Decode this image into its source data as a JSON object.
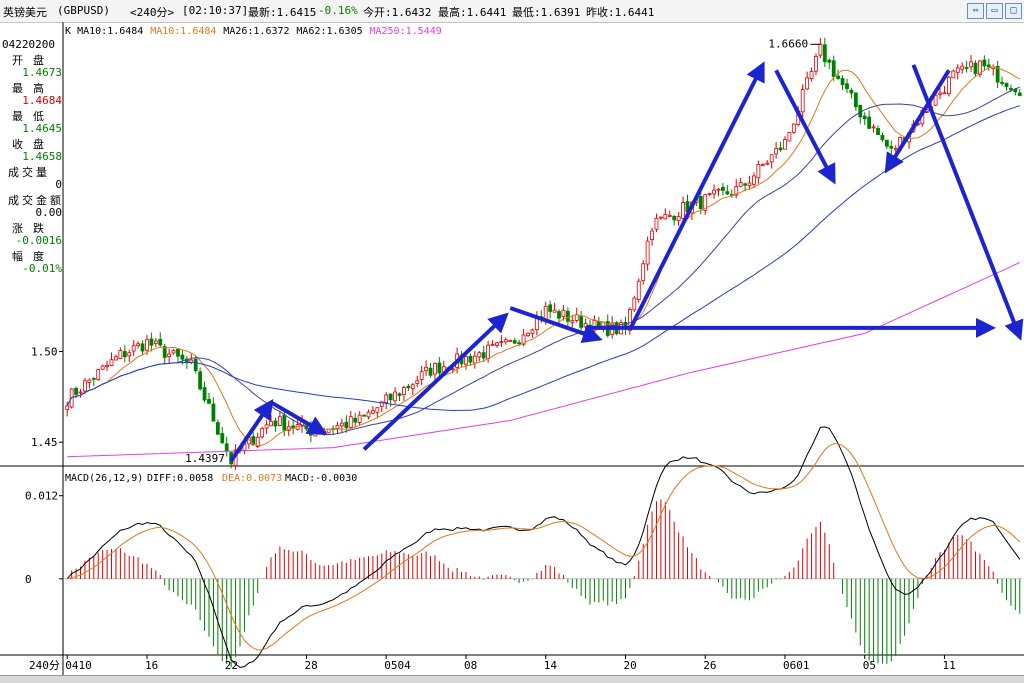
{
  "window": {
    "name": "英镑美元",
    "code": "(GBPUSD)",
    "period": "<240分>",
    "time": "[02:10:37]",
    "latest": "最新:1.6415",
    "change_pct": "-0.16%",
    "open_today": "今开:1.6432",
    "high": "最高:1.6441",
    "low": "最低:1.6391",
    "prev_close": "昨收:1.6441"
  },
  "left_panel": {
    "date": "04220200",
    "items": [
      {
        "label": "开盘",
        "value": "1.4673",
        "color": "#008000"
      },
      {
        "label": "最高",
        "value": "1.4684",
        "color": "#e00000"
      },
      {
        "label": "最低",
        "value": "1.4645",
        "color": "#008000"
      },
      {
        "label": "收盘",
        "value": "1.4658",
        "color": "#008000"
      },
      {
        "label": "成交量",
        "value": "0",
        "color": "#000000"
      },
      {
        "label": "成交金额",
        "value": "0.00",
        "color": "#000000"
      },
      {
        "label": "涨跌",
        "value": "-0.0016",
        "color": "#008000"
      },
      {
        "label": "幅度",
        "value": "-0.01%",
        "color": "#008000"
      }
    ]
  },
  "colors": {
    "up": "#e00000",
    "down": "#008000",
    "ma10": "#e07820",
    "ma26": "#4040a0",
    "ma62": "#2040c0",
    "ma250": "#e040e0",
    "annotation": "#1c24d0",
    "diff": "#000000",
    "dea": "#e07820"
  },
  "chart_data": [
    {
      "type": "candlestick",
      "legend": [
        {
          "label": "K",
          "color": "#000000"
        },
        {
          "label": "MA10:1.6484",
          "color": "#000000"
        },
        {
          "label": "MA10:1.6484",
          "color": "#e07820"
        },
        {
          "label": "MA26:1.6372",
          "color": "#000000"
        },
        {
          "label": "MA62:1.6305",
          "color": "#000000"
        },
        {
          "label": "MA250:1.5449",
          "color": "#e040e0"
        }
      ],
      "yticks": [
        1.45,
        1.5
      ],
      "ylim": [
        1.438,
        1.675
      ],
      "annotations": [
        {
          "text": "1.6660",
          "x": 170,
          "y": 1.666
        },
        {
          "text": "1.4397",
          "x": 37,
          "y": 1.4397
        }
      ],
      "x_ticks": [
        {
          "label": "0410",
          "index": 0
        },
        {
          "label": "16",
          "index": 18
        },
        {
          "label": "22",
          "index": 36
        },
        {
          "label": "28",
          "index": 54
        },
        {
          "label": "0504",
          "index": 72
        },
        {
          "label": "08",
          "index": 90
        },
        {
          "label": "14",
          "index": 108
        },
        {
          "label": "20",
          "index": 126
        },
        {
          "label": "26",
          "index": 144
        },
        {
          "label": "0601",
          "index": 162
        },
        {
          "label": "05",
          "index": 180
        },
        {
          "label": "11",
          "index": 198
        }
      ],
      "x_unit_label": "240分",
      "n_bars": 216,
      "keypoints": [
        [
          0,
          1.474
        ],
        [
          12,
          1.498
        ],
        [
          18,
          1.505
        ],
        [
          28,
          1.492
        ],
        [
          37,
          1.4397
        ],
        [
          46,
          1.462
        ],
        [
          56,
          1.456
        ],
        [
          66,
          1.462
        ],
        [
          82,
          1.49
        ],
        [
          100,
          1.504
        ],
        [
          108,
          1.523
        ],
        [
          120,
          1.513
        ],
        [
          126,
          1.512
        ],
        [
          132,
          1.57
        ],
        [
          140,
          1.58
        ],
        [
          152,
          1.59
        ],
        [
          162,
          1.615
        ],
        [
          170,
          1.666
        ],
        [
          178,
          1.635
        ],
        [
          186,
          1.61
        ],
        [
          192,
          1.628
        ],
        [
          200,
          1.652
        ],
        [
          206,
          1.658
        ],
        [
          215,
          1.645
        ]
      ],
      "ma250_keypoints": [
        [
          0,
          1.442
        ],
        [
          60,
          1.447
        ],
        [
          100,
          1.462
        ],
        [
          140,
          1.488
        ],
        [
          180,
          1.51
        ],
        [
          215,
          1.549
        ]
      ]
    },
    {
      "type": "macd",
      "label": "MACD(26,12,9)",
      "diff_label": "DIFF:0.0058",
      "dea_label": "DEA:0.0073",
      "macd_label": "MACD:-0.0030",
      "yticks": [
        0,
        0.012
      ],
      "ylim": [
        -0.011,
        0.016
      ]
    }
  ]
}
